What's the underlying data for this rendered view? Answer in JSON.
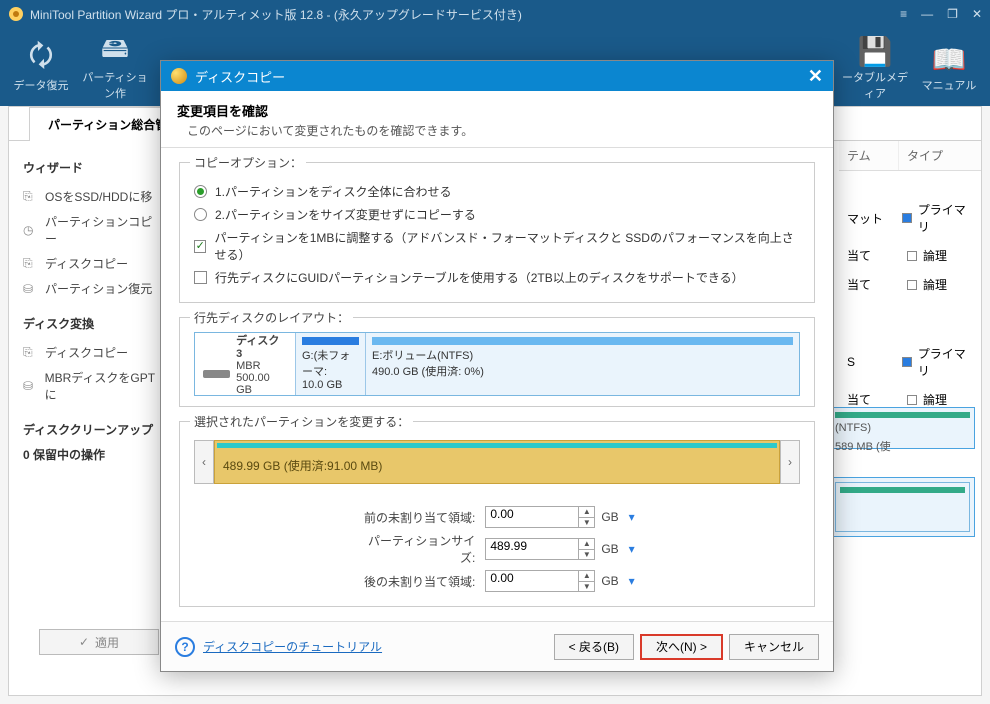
{
  "titlebar": {
    "text": "MiniTool Partition Wizard プロ・アルティメット版 12.8 - (永久アップグレードサービス付き)"
  },
  "toolbar": {
    "items": [
      {
        "label": "データ復元"
      },
      {
        "label": "パーティション作"
      },
      {
        "label": ""
      },
      {
        "label": ""
      },
      {
        "label": ""
      },
      {
        "label": "ータブルメディア"
      },
      {
        "label": "マニュアル"
      }
    ]
  },
  "main": {
    "tab": "パーティション総合管理"
  },
  "sidebar": {
    "group1": "ウィザード",
    "items1": [
      {
        "icon": "⎘",
        "label": "OSをSSD/HDDに移"
      },
      {
        "icon": "◷",
        "label": "パーティションコピー"
      },
      {
        "icon": "⎘",
        "label": "ディスクコピー"
      },
      {
        "icon": "⛁",
        "label": "パーティション復元"
      }
    ],
    "group2": "ディスク変換",
    "items2": [
      {
        "icon": "⎘",
        "label": "ディスクコピー"
      },
      {
        "icon": "⛁",
        "label": "MBRディスクをGPTに"
      }
    ],
    "group3": "ディスククリーンアップ",
    "pending": "0 保留中の操作",
    "apply": "✓ 適用"
  },
  "right_table": {
    "col1": "テム",
    "col2": "タイプ",
    "rows": [
      {
        "c1": "マット",
        "sq": "#2a7de0",
        "c2": "プライマリ"
      },
      {
        "c1": "当て",
        "sq": "#999",
        "c2": "論理"
      },
      {
        "c1": "当て",
        "sq": "#999",
        "c2": "論理"
      },
      {
        "c1": "S",
        "sq": "#2a7de0",
        "c2": "プライマリ"
      },
      {
        "c1": "当て",
        "sq": "#999",
        "c2": "論理"
      }
    ]
  },
  "layout_preview": {
    "label1": "(NTFS)",
    "label2": "589 MB (使"
  },
  "modal": {
    "title": "ディスクコピー",
    "head_title": "変更項目を確認",
    "head_sub": "このページにおいて変更されたものを確認できます。",
    "opt_legend": "コピーオプション：",
    "radio1": "1.パーティションをディスク全体に合わせる",
    "radio2": "2.パーティションをサイズ変更せずにコピーする",
    "check1": "パーティションを1MBに調整する（アドバンスド・フォーマットディスクと SSDのパフォーマンスを向上させる）",
    "check2": "行先ディスクにGUIDパーティションテーブルを使用する（2TB以上のディスクをサポートできる）",
    "layout_legend": "行先ディスクのレイアウト：",
    "disk": {
      "name": "ディスク 3",
      "scheme": "MBR",
      "size": "500.00 GB",
      "p1_label": "G:(未フォーマ:",
      "p1_size": "10.0 GB",
      "p2_label": "E:ボリューム(NTFS)",
      "p2_size": "490.0 GB (使用済: 0%)"
    },
    "sel_legend": "選択されたパーティションを変更する：",
    "slider_text": "489.99 GB (使用済:91.00 MB)",
    "form": {
      "before_label": "前の未割り当て領域:",
      "before_val": "0.00",
      "size_label": "パーティションサイズ:",
      "size_val": "489.99",
      "after_label": "後の未割り当て領域:",
      "after_val": "0.00",
      "unit": "GB"
    },
    "help_link": "ディスクコピーのチュートリアル",
    "btn_back": "< 戻る(B)",
    "btn_next": "次へ(N) >",
    "btn_cancel": "キャンセル"
  }
}
